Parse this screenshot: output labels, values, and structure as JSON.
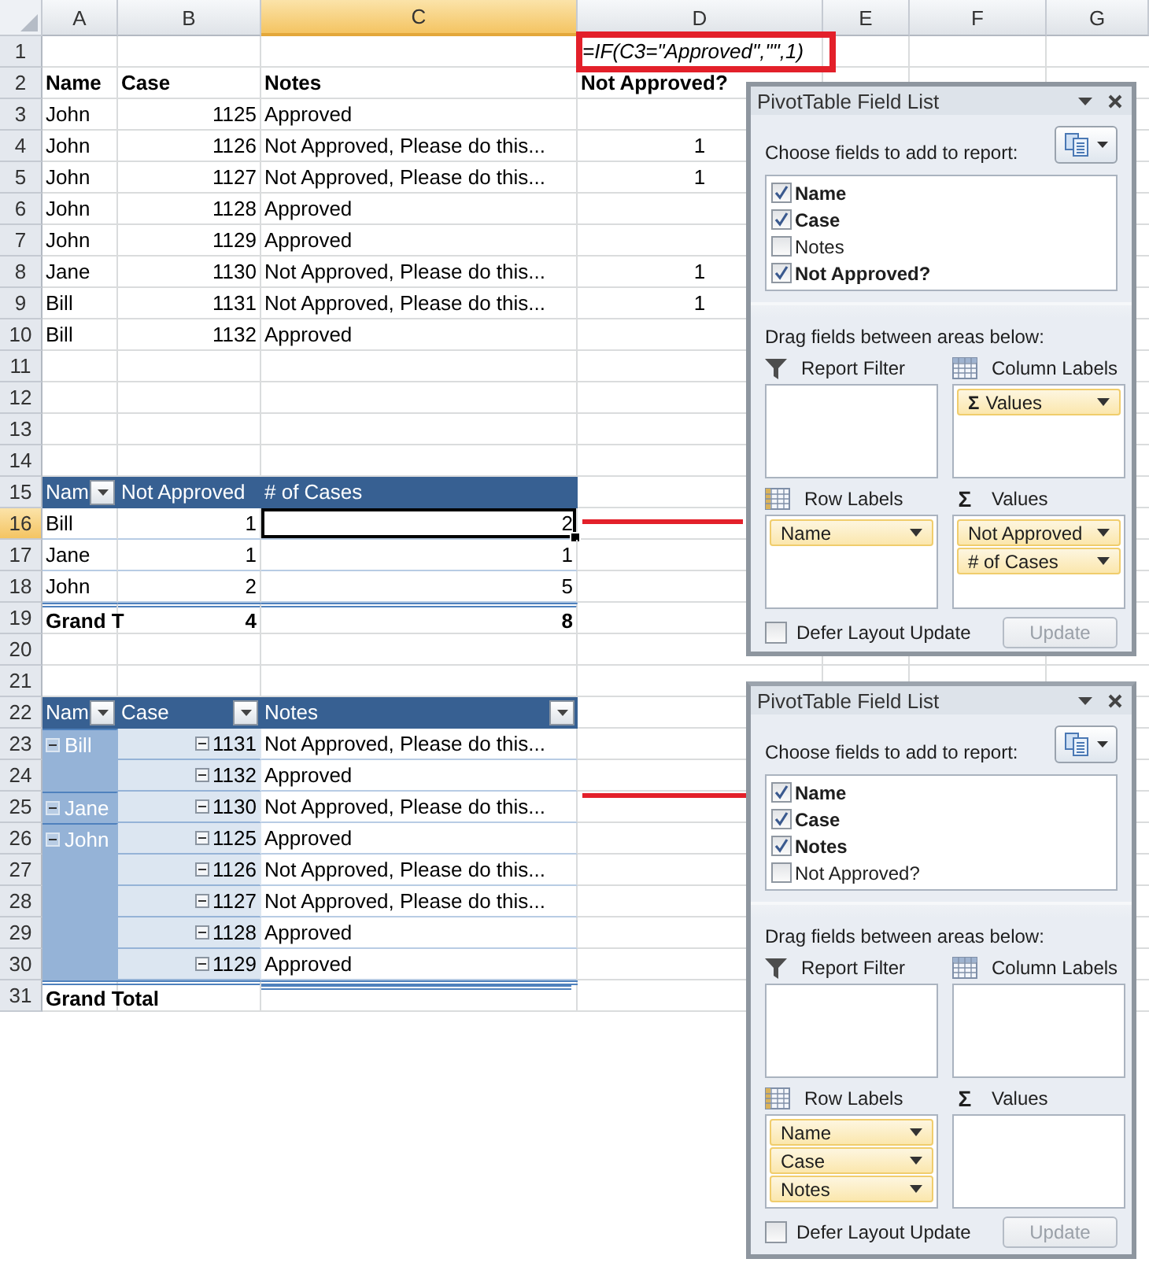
{
  "sheet": {
    "columns": [
      {
        "label": "A",
        "selected": false
      },
      {
        "label": "B",
        "selected": false
      },
      {
        "label": "C",
        "selected": true
      },
      {
        "label": "D",
        "selected": false
      },
      {
        "label": "E",
        "selected": false
      },
      {
        "label": "F",
        "selected": false
      },
      {
        "label": "G",
        "selected": false
      }
    ],
    "rows": [
      {
        "number": "1",
        "selected": false,
        "kind": "plain",
        "cells": [
          null,
          null,
          null,
          {
            "text": "=IF(C3=\"Approved\",\"\",1)",
            "kind": "formula",
            "selected": false
          }
        ]
      },
      {
        "number": "2",
        "selected": false,
        "kind": "plain",
        "cells": [
          {
            "text": "Name",
            "kind": "header",
            "selected": false
          },
          {
            "text": "Case",
            "kind": "header",
            "selected": false
          },
          {
            "text": "Notes",
            "kind": "header",
            "selected": false
          },
          {
            "text": "Not Approved?",
            "kind": "header",
            "selected": false
          }
        ]
      },
      {
        "number": "3",
        "selected": false,
        "kind": "plain",
        "cells": [
          {
            "text": "John",
            "kind": "text",
            "selected": false
          },
          {
            "text": "1125",
            "kind": "number",
            "selected": false
          },
          {
            "text": "Approved",
            "kind": "text",
            "selected": false
          },
          null
        ]
      },
      {
        "number": "4",
        "selected": false,
        "kind": "plain",
        "cells": [
          {
            "text": "John",
            "kind": "text",
            "selected": false
          },
          {
            "text": "1126",
            "kind": "number",
            "selected": false
          },
          {
            "text": "Not Approved, Please do this...",
            "kind": "text",
            "selected": false
          },
          {
            "text": "1",
            "kind": "center",
            "selected": false
          }
        ]
      },
      {
        "number": "5",
        "selected": false,
        "kind": "plain",
        "cells": [
          {
            "text": "John",
            "kind": "text",
            "selected": false
          },
          {
            "text": "1127",
            "kind": "number",
            "selected": false
          },
          {
            "text": "Not Approved, Please do this...",
            "kind": "text",
            "selected": false
          },
          {
            "text": "1",
            "kind": "center",
            "selected": false
          }
        ]
      },
      {
        "number": "6",
        "selected": false,
        "kind": "plain",
        "cells": [
          {
            "text": "John",
            "kind": "text",
            "selected": false
          },
          {
            "text": "1128",
            "kind": "number",
            "selected": false
          },
          {
            "text": "Approved",
            "kind": "text",
            "selected": false
          },
          null
        ]
      },
      {
        "number": "7",
        "selected": false,
        "kind": "plain",
        "cells": [
          {
            "text": "John",
            "kind": "text",
            "selected": false
          },
          {
            "text": "1129",
            "kind": "number",
            "selected": false
          },
          {
            "text": "Approved",
            "kind": "text",
            "selected": false
          },
          null
        ]
      },
      {
        "number": "8",
        "selected": false,
        "kind": "plain",
        "cells": [
          {
            "text": "Jane",
            "kind": "text",
            "selected": false
          },
          {
            "text": "1130",
            "kind": "number",
            "selected": false
          },
          {
            "text": "Not Approved, Please do this...",
            "kind": "text",
            "selected": false
          },
          {
            "text": "1",
            "kind": "center",
            "selected": false
          }
        ]
      },
      {
        "number": "9",
        "selected": false,
        "kind": "plain",
        "cells": [
          {
            "text": "Bill",
            "kind": "text",
            "selected": false
          },
          {
            "text": "1131",
            "kind": "number",
            "selected": false
          },
          {
            "text": "Not Approved, Please do this...",
            "kind": "text",
            "selected": false
          },
          {
            "text": "1",
            "kind": "center",
            "selected": false
          }
        ]
      },
      {
        "number": "10",
        "selected": false,
        "kind": "plain",
        "cells": [
          {
            "text": "Bill",
            "kind": "text",
            "selected": false
          },
          {
            "text": "1132",
            "kind": "number",
            "selected": false
          },
          {
            "text": "Approved",
            "kind": "text",
            "selected": false
          },
          null
        ]
      },
      {
        "number": "11",
        "selected": false,
        "kind": "plain"
      },
      {
        "number": "12",
        "selected": false,
        "kind": "plain"
      },
      {
        "number": "13",
        "selected": false,
        "kind": "plain"
      },
      {
        "number": "14",
        "selected": false,
        "kind": "plain"
      },
      {
        "number": "15",
        "selected": false,
        "kind": "pivot-header",
        "cells": [
          {
            "text": "Nam",
            "kind": "pivot-head",
            "dropdown": true,
            "selected": false
          },
          {
            "text": "Not Approved",
            "kind": "pivot-head",
            "dropdown": false,
            "selected": false
          },
          {
            "text": "# of Cases",
            "kind": "pivot-head",
            "dropdown": false,
            "selected": false
          },
          null
        ]
      },
      {
        "number": "16",
        "selected": true,
        "kind": "pivot-row",
        "cells": [
          {
            "text": "Bill",
            "kind": "text",
            "selected": false
          },
          {
            "text": "1",
            "kind": "number",
            "selected": false
          },
          {
            "text": "2",
            "kind": "number",
            "selected": true
          },
          null
        ]
      },
      {
        "number": "17",
        "selected": false,
        "kind": "pivot-row",
        "cells": [
          {
            "text": "Jane",
            "kind": "text",
            "selected": false
          },
          {
            "text": "1",
            "kind": "number",
            "selected": false
          },
          {
            "text": "1",
            "kind": "number",
            "selected": false
          },
          null
        ]
      },
      {
        "number": "18",
        "selected": false,
        "kind": "pivot-row",
        "cells": [
          {
            "text": "John",
            "kind": "text",
            "selected": false
          },
          {
            "text": "2",
            "kind": "number",
            "selected": false
          },
          {
            "text": "5",
            "kind": "number",
            "selected": false
          },
          null
        ]
      },
      {
        "number": "19",
        "selected": false,
        "kind": "pivot-total",
        "cells": [
          {
            "text": "Grand T",
            "kind": "total",
            "selected": false
          },
          {
            "text": "4",
            "kind": "total-number",
            "selected": false
          },
          {
            "text": "8",
            "kind": "total-number",
            "selected": false
          },
          null
        ]
      },
      {
        "number": "20",
        "selected": false,
        "kind": "plain"
      },
      {
        "number": "21",
        "selected": false,
        "kind": "plain"
      },
      {
        "number": "22",
        "selected": false,
        "kind": "pivot-header",
        "cells": [
          {
            "text": "Nam",
            "kind": "pivot-head",
            "dropdown": true,
            "selected": false
          },
          {
            "text": "Case",
            "kind": "pivot-head",
            "dropdown": true,
            "selected": false
          },
          {
            "text": "Notes",
            "kind": "pivot-head",
            "dropdown": true,
            "selected": false
          },
          null
        ]
      },
      {
        "number": "23",
        "selected": false,
        "kind": "pivot-row",
        "cells": [
          {
            "text": "Bill",
            "kind": "row-label",
            "expanded": true,
            "selected": false
          },
          {
            "text": "1131",
            "kind": "item",
            "expanded": true,
            "selected": false
          },
          {
            "text": "Not Approved, Please do this...",
            "kind": "text",
            "selected": false
          },
          null
        ]
      },
      {
        "number": "24",
        "selected": false,
        "kind": "pivot-row",
        "cells": [
          {
            "kind": "row-label",
            "selected": false
          },
          {
            "text": "1132",
            "kind": "item",
            "expanded": true,
            "selected": false
          },
          {
            "text": "Approved",
            "kind": "text",
            "selected": false
          },
          null
        ]
      },
      {
        "number": "25",
        "selected": false,
        "kind": "pivot-row",
        "cells": [
          {
            "text": "Jane",
            "kind": "row-label",
            "expanded": true,
            "selected": false
          },
          {
            "text": "1130",
            "kind": "item",
            "expanded": true,
            "selected": false
          },
          {
            "text": "Not Approved, Please do this...",
            "kind": "text",
            "selected": false
          },
          null
        ]
      },
      {
        "number": "26",
        "selected": false,
        "kind": "pivot-row",
        "cells": [
          {
            "text": "John",
            "kind": "row-label",
            "expanded": true,
            "selected": false
          },
          {
            "text": "1125",
            "kind": "item",
            "expanded": true,
            "selected": false
          },
          {
            "text": "Approved",
            "kind": "text",
            "selected": false
          },
          null
        ]
      },
      {
        "number": "27",
        "selected": false,
        "kind": "pivot-row",
        "cells": [
          {
            "kind": "row-label",
            "selected": false
          },
          {
            "text": "1126",
            "kind": "item",
            "expanded": true,
            "selected": false
          },
          {
            "text": "Not Approved, Please do this...",
            "kind": "text",
            "selected": false
          },
          null
        ]
      },
      {
        "number": "28",
        "selected": false,
        "kind": "pivot-row",
        "cells": [
          {
            "kind": "row-label",
            "selected": false
          },
          {
            "text": "1127",
            "kind": "item",
            "expanded": true,
            "selected": false
          },
          {
            "text": "Not Approved, Please do this...",
            "kind": "text",
            "selected": false
          },
          null
        ]
      },
      {
        "number": "29",
        "selected": false,
        "kind": "pivot-row",
        "cells": [
          {
            "kind": "row-label",
            "selected": false
          },
          {
            "text": "1128",
            "kind": "item",
            "expanded": true,
            "selected": false
          },
          {
            "text": "Approved",
            "kind": "text",
            "selected": false
          },
          null
        ]
      },
      {
        "number": "30",
        "selected": false,
        "kind": "pivot-row",
        "cells": [
          {
            "kind": "row-label",
            "selected": false
          },
          {
            "text": "1129",
            "kind": "item",
            "expanded": true,
            "selected": false
          },
          {
            "text": "Approved",
            "kind": "text",
            "selected": false
          },
          null
        ]
      },
      {
        "number": "31",
        "selected": false,
        "kind": "pivot-total",
        "cells": [
          {
            "text": "Grand Total",
            "kind": "total",
            "selected": false
          },
          null,
          null,
          null
        ]
      }
    ]
  },
  "panels": [
    {
      "title": "PivotTable Field List",
      "choose_label": "Choose fields to add to report:",
      "fields": [
        {
          "label": "Name",
          "checked": true
        },
        {
          "label": "Case",
          "checked": true
        },
        {
          "label": "Notes",
          "checked": false
        },
        {
          "label": "Not Approved?",
          "checked": true
        }
      ],
      "drag_label": "Drag fields between areas below:",
      "areas": [
        {
          "kind": "filter",
          "label": "Report Filter"
        },
        {
          "kind": "columns",
          "label": "Column Labels",
          "chips": [
            {
              "label": "Values",
              "symbol": "Σ"
            }
          ]
        },
        {
          "kind": "rows",
          "label": "Row Labels",
          "chips": [
            {
              "label": "Name"
            }
          ]
        },
        {
          "kind": "values",
          "label": "Values",
          "symbol": "Σ",
          "chips": [
            {
              "label": "Not Approved"
            },
            {
              "label": "# of Cases"
            }
          ]
        }
      ],
      "defer_update": {
        "label": "Defer Layout Update",
        "checked": false
      },
      "update_button": {
        "label": "Update",
        "disabled": true
      }
    },
    {
      "title": "PivotTable Field List",
      "choose_label": "Choose fields to add to report:",
      "fields": [
        {
          "label": "Name",
          "checked": true
        },
        {
          "label": "Case",
          "checked": true
        },
        {
          "label": "Notes",
          "checked": true
        },
        {
          "label": "Not Approved?",
          "checked": false
        }
      ],
      "drag_label": "Drag fields between areas below:",
      "areas": [
        {
          "kind": "filter",
          "label": "Report Filter"
        },
        {
          "kind": "columns",
          "label": "Column Labels"
        },
        {
          "kind": "rows",
          "label": "Row Labels",
          "chips": [
            {
              "label": "Name"
            },
            {
              "label": "Case"
            },
            {
              "label": "Notes"
            }
          ]
        },
        {
          "kind": "values",
          "label": "Values",
          "symbol": "Σ"
        }
      ],
      "defer_update": {
        "label": "Defer Layout Update",
        "checked": false
      },
      "update_button": {
        "label": "Update",
        "disabled": true
      }
    }
  ]
}
